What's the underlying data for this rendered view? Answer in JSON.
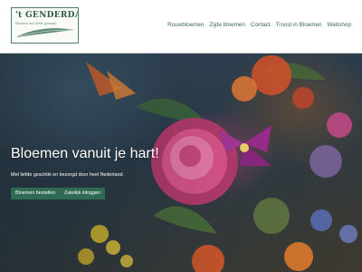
{
  "brand": {
    "name": "'t GENDERDAL",
    "tagline": "bloemen met liefde gemaakt",
    "color": "#2f5d4a"
  },
  "nav": {
    "items": [
      {
        "label": "Rouwbloemen"
      },
      {
        "label": "Zijde bloemen"
      },
      {
        "label": "Contact"
      },
      {
        "label": "Troost in Bloemen"
      },
      {
        "label": "Webshop"
      }
    ]
  },
  "hero": {
    "title": "Bloemen vanuit je hart!",
    "subtitle": "Met liefde geschikt en bezorgd door heel Nederland.",
    "primary_button": "Bloemen bestellen",
    "secondary_button": "Zakelijk inloggen",
    "button_color": "#2f6a55"
  }
}
